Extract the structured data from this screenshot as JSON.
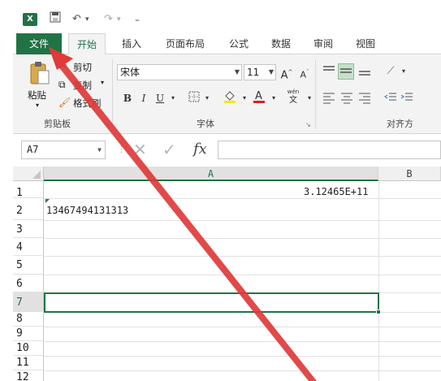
{
  "qat": {
    "undo_glyph": "↶",
    "redo_glyph": "↷",
    "more_glyph": "▾",
    "customize_glyph": "₌"
  },
  "tabs": [
    "文件",
    "开始",
    "插入",
    "页面布局",
    "公式",
    "数据",
    "审阅",
    "视图"
  ],
  "ribbon": {
    "paste_label": "粘贴",
    "cut_label": "剪切",
    "copy_label": "复制",
    "format_painter_label": "格式刷",
    "clipboard_group": "剪贴板",
    "font_name": "宋体",
    "font_size": "11",
    "bold": "B",
    "italic": "I",
    "underline": "U",
    "phonetic_top": "wén",
    "phonetic_bottom": "文",
    "font_group": "字体",
    "alignment_group": "对齐方"
  },
  "formula_bar": {
    "name_box": "A7",
    "fx_label": "fx",
    "formula_value": ""
  },
  "sheet": {
    "columns": [
      "A",
      "B"
    ],
    "rows": [
      "1",
      "2",
      "3",
      "4",
      "5",
      "6",
      "7",
      "8",
      "9",
      "10",
      "11",
      "12"
    ],
    "cells": {
      "A1": "3.12465E+11",
      "A2": "13467494131313"
    },
    "selected_cell": "A7"
  },
  "colors": {
    "accent": "#217346",
    "annotation_arrow": "#e03a3a"
  }
}
